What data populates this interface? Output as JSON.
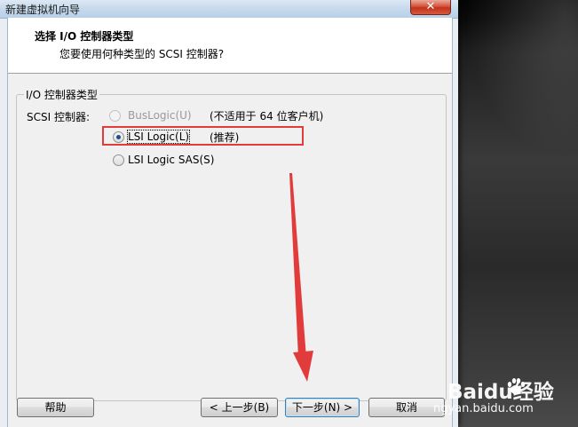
{
  "window": {
    "title": "新建虚拟机向导",
    "close_glyph": "✕"
  },
  "header": {
    "title": "选择 I/O 控制器类型",
    "subtitle": "您要使用何种类型的 SCSI 控制器?"
  },
  "group": {
    "label": "I/O 控制器类型",
    "row_label": "SCSI 控制器:"
  },
  "options": [
    {
      "label": "BusLogic(U)",
      "note": "(不适用于 64 位客户机)",
      "state": "disabled"
    },
    {
      "label": "LSI Logic(L)",
      "note": "(推荐)",
      "state": "checked"
    },
    {
      "label": "LSI Logic SAS(S)",
      "note": "",
      "state": "unchecked"
    }
  ],
  "buttons": {
    "help": "帮助",
    "back": "< 上一步(B)",
    "next": "下一步(N) >",
    "cancel": "取消"
  },
  "watermark": {
    "top": "Baidu经验",
    "bottom": "ngyan.baidu.com"
  },
  "colors": {
    "annotation": "#e23b3b",
    "selected_dot": "#1e4f8a"
  }
}
